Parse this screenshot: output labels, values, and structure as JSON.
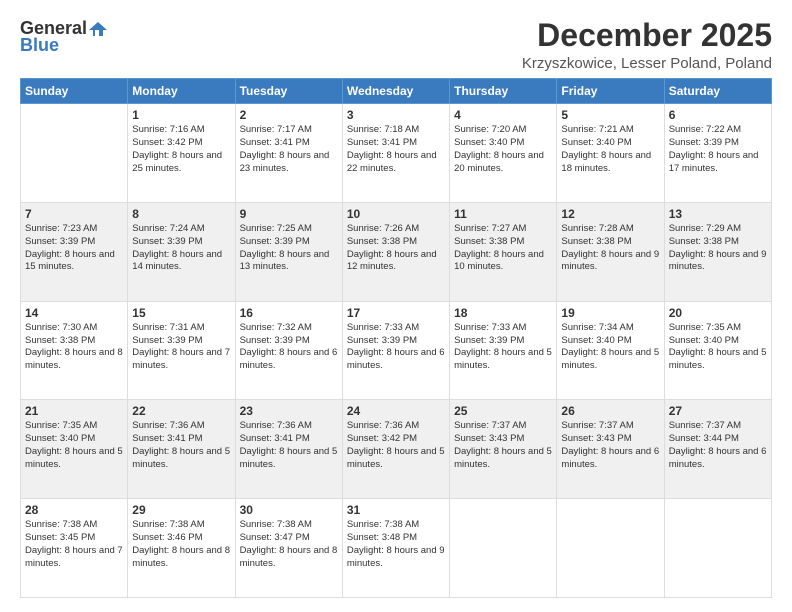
{
  "logo": {
    "general": "General",
    "blue": "Blue"
  },
  "header": {
    "month": "December 2025",
    "location": "Krzyszkowice, Lesser Poland, Poland"
  },
  "weekdays": [
    "Sunday",
    "Monday",
    "Tuesday",
    "Wednesday",
    "Thursday",
    "Friday",
    "Saturday"
  ],
  "weeks": [
    [
      {
        "day": "",
        "sunrise": "",
        "sunset": "",
        "daylight": ""
      },
      {
        "day": "1",
        "sunrise": "Sunrise: 7:16 AM",
        "sunset": "Sunset: 3:42 PM",
        "daylight": "Daylight: 8 hours and 25 minutes."
      },
      {
        "day": "2",
        "sunrise": "Sunrise: 7:17 AM",
        "sunset": "Sunset: 3:41 PM",
        "daylight": "Daylight: 8 hours and 23 minutes."
      },
      {
        "day": "3",
        "sunrise": "Sunrise: 7:18 AM",
        "sunset": "Sunset: 3:41 PM",
        "daylight": "Daylight: 8 hours and 22 minutes."
      },
      {
        "day": "4",
        "sunrise": "Sunrise: 7:20 AM",
        "sunset": "Sunset: 3:40 PM",
        "daylight": "Daylight: 8 hours and 20 minutes."
      },
      {
        "day": "5",
        "sunrise": "Sunrise: 7:21 AM",
        "sunset": "Sunset: 3:40 PM",
        "daylight": "Daylight: 8 hours and 18 minutes."
      },
      {
        "day": "6",
        "sunrise": "Sunrise: 7:22 AM",
        "sunset": "Sunset: 3:39 PM",
        "daylight": "Daylight: 8 hours and 17 minutes."
      }
    ],
    [
      {
        "day": "7",
        "sunrise": "Sunrise: 7:23 AM",
        "sunset": "Sunset: 3:39 PM",
        "daylight": "Daylight: 8 hours and 15 minutes."
      },
      {
        "day": "8",
        "sunrise": "Sunrise: 7:24 AM",
        "sunset": "Sunset: 3:39 PM",
        "daylight": "Daylight: 8 hours and 14 minutes."
      },
      {
        "day": "9",
        "sunrise": "Sunrise: 7:25 AM",
        "sunset": "Sunset: 3:39 PM",
        "daylight": "Daylight: 8 hours and 13 minutes."
      },
      {
        "day": "10",
        "sunrise": "Sunrise: 7:26 AM",
        "sunset": "Sunset: 3:38 PM",
        "daylight": "Daylight: 8 hours and 12 minutes."
      },
      {
        "day": "11",
        "sunrise": "Sunrise: 7:27 AM",
        "sunset": "Sunset: 3:38 PM",
        "daylight": "Daylight: 8 hours and 10 minutes."
      },
      {
        "day": "12",
        "sunrise": "Sunrise: 7:28 AM",
        "sunset": "Sunset: 3:38 PM",
        "daylight": "Daylight: 8 hours and 9 minutes."
      },
      {
        "day": "13",
        "sunrise": "Sunrise: 7:29 AM",
        "sunset": "Sunset: 3:38 PM",
        "daylight": "Daylight: 8 hours and 9 minutes."
      }
    ],
    [
      {
        "day": "14",
        "sunrise": "Sunrise: 7:30 AM",
        "sunset": "Sunset: 3:38 PM",
        "daylight": "Daylight: 8 hours and 8 minutes."
      },
      {
        "day": "15",
        "sunrise": "Sunrise: 7:31 AM",
        "sunset": "Sunset: 3:39 PM",
        "daylight": "Daylight: 8 hours and 7 minutes."
      },
      {
        "day": "16",
        "sunrise": "Sunrise: 7:32 AM",
        "sunset": "Sunset: 3:39 PM",
        "daylight": "Daylight: 8 hours and 6 minutes."
      },
      {
        "day": "17",
        "sunrise": "Sunrise: 7:33 AM",
        "sunset": "Sunset: 3:39 PM",
        "daylight": "Daylight: 8 hours and 6 minutes."
      },
      {
        "day": "18",
        "sunrise": "Sunrise: 7:33 AM",
        "sunset": "Sunset: 3:39 PM",
        "daylight": "Daylight: 8 hours and 5 minutes."
      },
      {
        "day": "19",
        "sunrise": "Sunrise: 7:34 AM",
        "sunset": "Sunset: 3:40 PM",
        "daylight": "Daylight: 8 hours and 5 minutes."
      },
      {
        "day": "20",
        "sunrise": "Sunrise: 7:35 AM",
        "sunset": "Sunset: 3:40 PM",
        "daylight": "Daylight: 8 hours and 5 minutes."
      }
    ],
    [
      {
        "day": "21",
        "sunrise": "Sunrise: 7:35 AM",
        "sunset": "Sunset: 3:40 PM",
        "daylight": "Daylight: 8 hours and 5 minutes."
      },
      {
        "day": "22",
        "sunrise": "Sunrise: 7:36 AM",
        "sunset": "Sunset: 3:41 PM",
        "daylight": "Daylight: 8 hours and 5 minutes."
      },
      {
        "day": "23",
        "sunrise": "Sunrise: 7:36 AM",
        "sunset": "Sunset: 3:41 PM",
        "daylight": "Daylight: 8 hours and 5 minutes."
      },
      {
        "day": "24",
        "sunrise": "Sunrise: 7:36 AM",
        "sunset": "Sunset: 3:42 PM",
        "daylight": "Daylight: 8 hours and 5 minutes."
      },
      {
        "day": "25",
        "sunrise": "Sunrise: 7:37 AM",
        "sunset": "Sunset: 3:43 PM",
        "daylight": "Daylight: 8 hours and 5 minutes."
      },
      {
        "day": "26",
        "sunrise": "Sunrise: 7:37 AM",
        "sunset": "Sunset: 3:43 PM",
        "daylight": "Daylight: 8 hours and 6 minutes."
      },
      {
        "day": "27",
        "sunrise": "Sunrise: 7:37 AM",
        "sunset": "Sunset: 3:44 PM",
        "daylight": "Daylight: 8 hours and 6 minutes."
      }
    ],
    [
      {
        "day": "28",
        "sunrise": "Sunrise: 7:38 AM",
        "sunset": "Sunset: 3:45 PM",
        "daylight": "Daylight: 8 hours and 7 minutes."
      },
      {
        "day": "29",
        "sunrise": "Sunrise: 7:38 AM",
        "sunset": "Sunset: 3:46 PM",
        "daylight": "Daylight: 8 hours and 8 minutes."
      },
      {
        "day": "30",
        "sunrise": "Sunrise: 7:38 AM",
        "sunset": "Sunset: 3:47 PM",
        "daylight": "Daylight: 8 hours and 8 minutes."
      },
      {
        "day": "31",
        "sunrise": "Sunrise: 7:38 AM",
        "sunset": "Sunset: 3:48 PM",
        "daylight": "Daylight: 8 hours and 9 minutes."
      },
      {
        "day": "",
        "sunrise": "",
        "sunset": "",
        "daylight": ""
      },
      {
        "day": "",
        "sunrise": "",
        "sunset": "",
        "daylight": ""
      },
      {
        "day": "",
        "sunrise": "",
        "sunset": "",
        "daylight": ""
      }
    ]
  ]
}
